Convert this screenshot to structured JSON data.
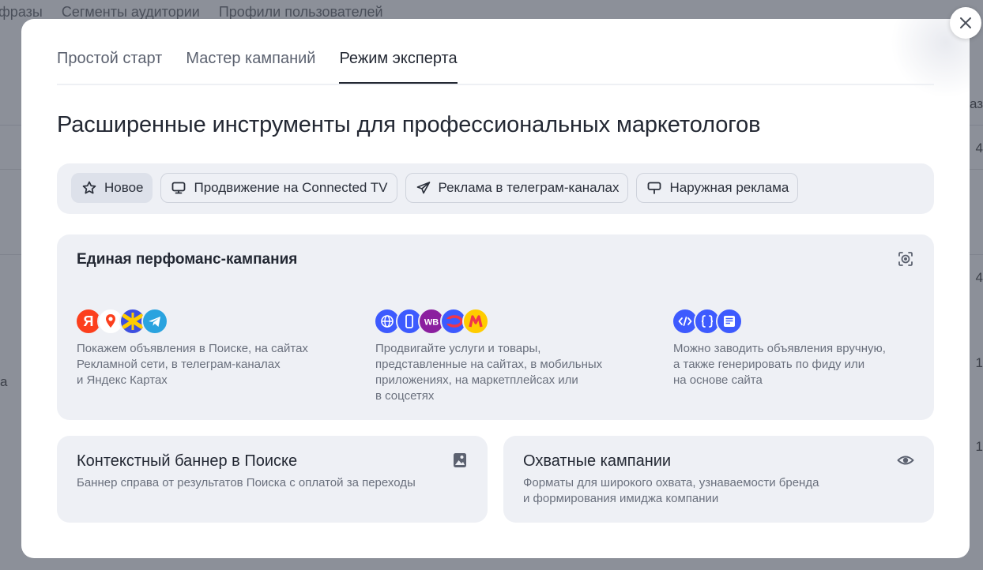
{
  "background": {
    "nav_items": [
      "фразы",
      "Сегменты аудитории",
      "Профили пользователей"
    ],
    "right_fragments": [
      "аз",
      "4",
      "4",
      "1",
      "1"
    ],
    "left_fragment": "а"
  },
  "modal": {
    "tabs": [
      {
        "label": "Простой старт",
        "active": false
      },
      {
        "label": "Мастер кампаний",
        "active": false
      },
      {
        "label": "Режим эксперта",
        "active": true
      }
    ],
    "title": "Расширенные инструменты для профессиональных маркетологов",
    "chips": [
      {
        "label": "Новое",
        "icon": "star-icon",
        "selected": true
      },
      {
        "label": "Продвижение на Connected TV",
        "icon": "tv-icon",
        "selected": false
      },
      {
        "label": "Реклама в телеграм-каналах",
        "icon": "telegram-icon",
        "selected": false
      },
      {
        "label": "Наружная реклама",
        "icon": "billboard-icon",
        "selected": false
      }
    ],
    "perf_card": {
      "title": "Единая перфоманс-кампания",
      "corner_icon": "target-icon",
      "features": [
        {
          "icons": [
            "yandex-icon",
            "maps-pin-icon",
            "yandex-network-icon",
            "telegram-icon"
          ],
          "lines": [
            "Покажем объявления в Поиске, на сайтах",
            "Рекламной сети, в телеграм-каналах",
            "и Яндекс Картах"
          ]
        },
        {
          "icons": [
            "globe-icon",
            "mobile-app-icon",
            "wildberries-icon",
            "ozon-icon",
            "yandex-market-icon"
          ],
          "wb_label": "WB",
          "lines": [
            "Продвигайте услуги и товары,",
            "представленные на сайтах, в мобильных",
            "приложениях, на маркетплейсах или",
            "в соцсетях"
          ]
        },
        {
          "icons": [
            "code-icon",
            "feed-icon",
            "site-icon"
          ],
          "lines": [
            "Можно заводить объявления вручную,",
            "а также генерировать по фиду или",
            "на основе сайта"
          ]
        }
      ]
    },
    "banner_card": {
      "title": "Контекстный баннер в Поиске",
      "desc": "Баннер справа от результатов Поиска с оплатой за переходы",
      "corner_icon": "image-icon"
    },
    "reach_card": {
      "title": "Охватные кампании",
      "desc_lines": [
        "Форматы для широкого охвата, узнаваемости бренда",
        "и формирования имиджа компании"
      ],
      "corner_icon": "eye-icon"
    }
  },
  "colors": {
    "accent_blue": "#3d5afe",
    "yandex_red": "#fc3f1d",
    "telegram": "#2aa3df",
    "wildberries": "#8b1f9f",
    "market_yellow": "#ffcc00"
  }
}
